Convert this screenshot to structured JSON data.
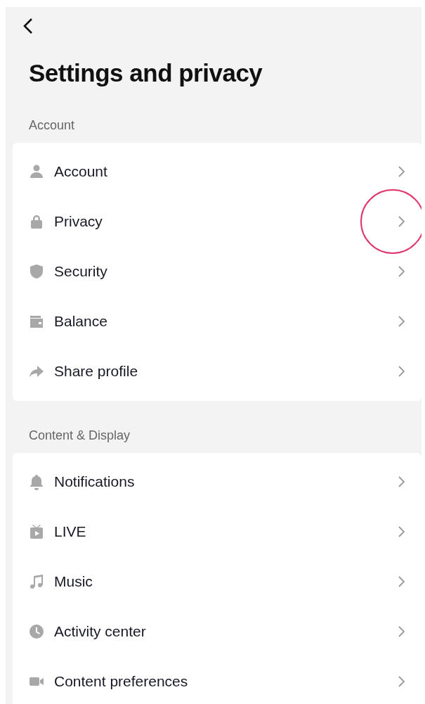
{
  "header": {
    "title": "Settings and privacy"
  },
  "sections": [
    {
      "label": "Account",
      "items": [
        {
          "kind": "person",
          "label": "Account",
          "highlighted": false
        },
        {
          "kind": "lock",
          "label": "Privacy",
          "highlighted": true
        },
        {
          "kind": "shield",
          "label": "Security",
          "highlighted": false
        },
        {
          "kind": "wallet",
          "label": "Balance",
          "highlighted": false
        },
        {
          "kind": "share",
          "label": "Share profile",
          "highlighted": false
        }
      ]
    },
    {
      "label": "Content & Display",
      "items": [
        {
          "kind": "bell",
          "label": "Notifications",
          "highlighted": false
        },
        {
          "kind": "tv",
          "label": "LIVE",
          "highlighted": false
        },
        {
          "kind": "music",
          "label": "Music",
          "highlighted": false
        },
        {
          "kind": "clock",
          "label": "Activity center",
          "highlighted": false
        },
        {
          "kind": "camera",
          "label": "Content preferences",
          "highlighted": false
        }
      ]
    }
  ]
}
